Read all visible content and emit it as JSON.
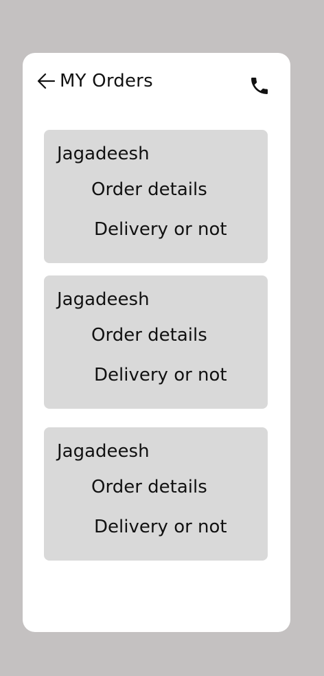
{
  "header": {
    "title": "MY Orders",
    "back_icon": "arrow-left-icon",
    "call_icon": "phone-icon"
  },
  "orders": [
    {
      "name": "Jagadeesh",
      "details": "Order details",
      "status": "Delivery or not"
    },
    {
      "name": "Jagadeesh",
      "details": "Order details",
      "status": "Delivery or not"
    },
    {
      "name": "Jagadeesh",
      "details": "Order details",
      "status": "Delivery or not"
    }
  ],
  "colors": {
    "background": "#c4c1c1",
    "panel": "#ffffff",
    "card": "#d9d9d9",
    "text": "#111111"
  }
}
